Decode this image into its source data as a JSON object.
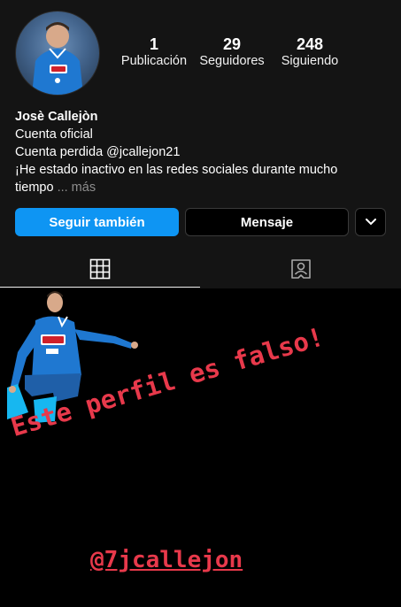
{
  "profile": {
    "stats": [
      {
        "value": "1",
        "label": "Publicación"
      },
      {
        "value": "29",
        "label": "Seguidores"
      },
      {
        "value": "248",
        "label": "Siguiendo"
      }
    ],
    "name": "Josè Callejòn",
    "bio_lines": [
      "Cuenta oficial",
      "Cuenta perdida @jcallejon21",
      "¡He estado inactivo en las redes sociales durante mucho",
      "tiempo"
    ],
    "more_label": "... más"
  },
  "actions": {
    "follow_label": "Seguir también",
    "message_label": "Mensaje"
  },
  "tabs": [
    {
      "icon": "grid-icon"
    },
    {
      "icon": "tagged-icon"
    }
  ],
  "overlay": {
    "headline": "Este perfil es falso!",
    "mention": "@7jcallejon"
  },
  "colors": {
    "accent_blue": "#0e95f3",
    "overlay_red": "#e8394b",
    "background": "#141414"
  }
}
